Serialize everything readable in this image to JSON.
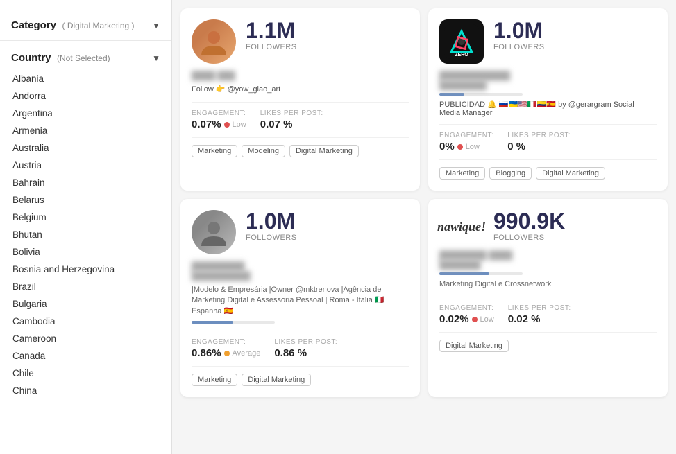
{
  "sidebar": {
    "category_label": "Category",
    "category_value": "( Digital Marketing )",
    "country_label": "Country",
    "country_value": "(Not Selected)",
    "countries": [
      "Albania",
      "Andorra",
      "Argentina",
      "Armenia",
      "Australia",
      "Austria",
      "Bahrain",
      "Belarus",
      "Belgium",
      "Bhutan",
      "Bolivia",
      "Bosnia and Herzegovina",
      "Brazil",
      "Bulgaria",
      "Cambodia",
      "Cameroon",
      "Canada",
      "Chile",
      "China"
    ]
  },
  "cards": [
    {
      "id": "card1",
      "followers": "1.1M",
      "followers_label": "FOLLOWERS",
      "name_blurred": "████ ███",
      "handle_blurred": "@yow_giao_art",
      "bio": "",
      "follow_text": "Follow 👉 @yow_giao_art",
      "engagement_label": "ENGAGEMENT:",
      "engagement_value": "0.07%",
      "engagement_level": "Low",
      "engagement_dot": "red",
      "likes_label": "LIKES PER POST:",
      "likes_value": "0.07 %",
      "tags": [
        "Marketing",
        "Modeling",
        "Digital Marketing"
      ],
      "avatar_type": "person1"
    },
    {
      "id": "card2",
      "followers": "1.0M",
      "followers_label": "FOLLOWERS",
      "name_blurred": "████████████",
      "handle_blurred": "████████████",
      "bio": "PUBLICIDAD 🔔",
      "progress_fill": 30,
      "extra_text": "by @gerargram Social Media Manager",
      "engagement_label": "ENGAGEMENT:",
      "engagement_value": "0%",
      "engagement_level": "Low",
      "engagement_dot": "red",
      "likes_label": "LIKES PER POST:",
      "likes_value": "0 %",
      "tags": [
        "Marketing",
        "Blogging",
        "Digital Marketing"
      ],
      "avatar_type": "logo1"
    },
    {
      "id": "card3",
      "followers": "1.0M",
      "followers_label": "FOLLOWERS",
      "name_blurred": "█████████",
      "handle_blurred": "██████████",
      "bio": "|Modelo & Empresária |Owner @mktrenova |Agência de Marketing Digital e Assessoria Pessoal | Roma - Italia 🇮🇹 Espanha 🇪🇸",
      "engagement_label": "ENGAGEMENT:",
      "engagement_value": "0.86%",
      "engagement_level": "Average",
      "engagement_dot": "orange",
      "likes_label": "LIKES PER POST:",
      "likes_value": "0.86 %",
      "tags": [
        "Marketing",
        "Digital Marketing"
      ],
      "avatar_type": "person2"
    },
    {
      "id": "card4",
      "followers": "990.9K",
      "followers_label": "FOLLOWERS",
      "name_blurred": "████████ ████",
      "handle_blurred": "███████",
      "bio": "Marketing Digital e Crossnetwork",
      "progress_fill": 60,
      "engagement_label": "ENGAGEMENT:",
      "engagement_value": "0.02%",
      "engagement_level": "Low",
      "engagement_dot": "red",
      "likes_label": "LIKES PER POST:",
      "likes_value": "0.02 %",
      "tags": [
        "Digital Marketing"
      ],
      "avatar_type": "textlogo"
    }
  ]
}
